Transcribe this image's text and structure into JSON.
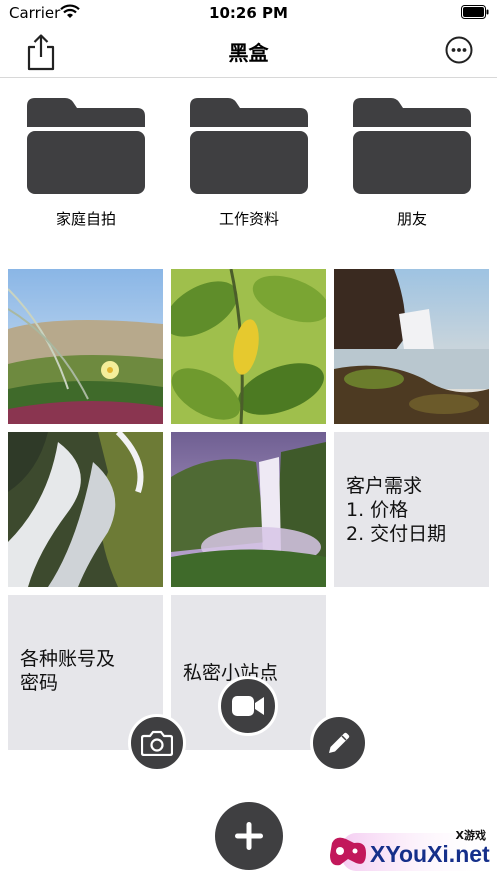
{
  "status_bar": {
    "carrier": "Carrier",
    "time": "10:26 PM"
  },
  "nav": {
    "title": "黑盒",
    "left_icon": "share-icon",
    "right_icon": "more-icon"
  },
  "folders": [
    {
      "label": "家庭自拍",
      "icon": "folder-icon"
    },
    {
      "label": "工作资料",
      "icon": "folder-icon"
    },
    {
      "label": "朋友",
      "icon": "folder-icon"
    }
  ],
  "notes": [
    {
      "text": "客户需求\n1. 价格\n2. 交付日期"
    },
    {
      "text": "各种账号及\n密码"
    },
    {
      "text": "私密小站点"
    }
  ],
  "fab": {
    "camera_icon": "camera-icon",
    "video_icon": "video-camera-icon",
    "edit_icon": "pencil-icon",
    "add_icon": "plus-icon"
  },
  "watermark": {
    "main": "XYouXi.net",
    "small": "X游戏"
  },
  "colors": {
    "icon_dark": "#3f3f41",
    "note_bg": "#e6e6ea",
    "divider": "#d8d8d8"
  }
}
